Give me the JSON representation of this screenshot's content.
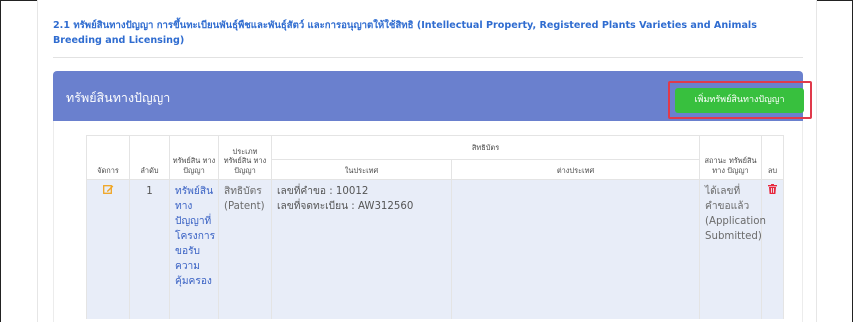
{
  "section": {
    "title": "2.1 ทรัพย์สินทางปัญญา การขึ้นทะเบียนพันธุ์พืชและพันธุ์สัตว์ และการอนุญาตให้ใช้สิทธิ (Intellectual Property, Registered Plants Varieties and Animals Breeding and Licensing)"
  },
  "panel": {
    "title": "ทรัพย์สินทางปัญญา",
    "add_button": "เพิ่มทรัพย์สินทางปัญญา"
  },
  "table": {
    "headers": {
      "manage": "จัดการ",
      "order": "ลำดับ",
      "ip": "ทรัพย์สิน ทาง ปัญญา",
      "ip_type": "ประเภท ทรัพย์สิน ทาง ปัญญา",
      "rights": "สิทธิบัตร",
      "domestic": "ในประเทศ",
      "foreign": "ต่างประเทศ",
      "status": "สถานะ ทรัพย์สินทาง ปัญญา",
      "delete": "ลบ"
    },
    "rows": [
      {
        "order": "1",
        "ip": "ทรัพย์สิน ทาง ปัญญาที่ โครงการ ขอรับ ความ คุ้มครอง",
        "ip_type": "สิทธิบัตร (Patent)",
        "request_no": "เลขที่คำขอ : 10012",
        "reg_no": "เลขที่จดทะเบียน : AW312560",
        "foreign": "",
        "status": "ได้เลขที่ คำขอแล้ว (Application Submitted)"
      }
    ]
  },
  "colors": {
    "panel": "#6a80ce",
    "button": "#38c03e",
    "highlight": "#e03a4b",
    "row": "#e8edf8",
    "link": "#3a62c4",
    "edit": "#f0a523",
    "delete": "#e8273d"
  }
}
